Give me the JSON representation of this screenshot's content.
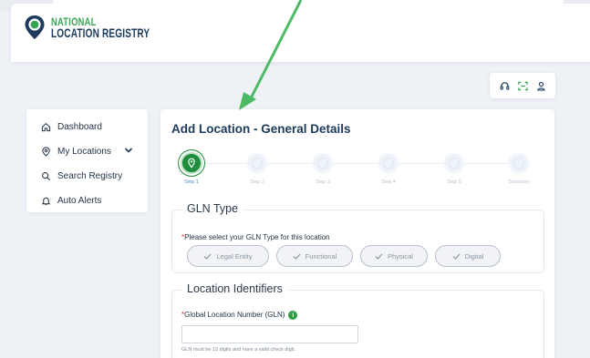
{
  "app": {
    "logo_line1": "NATIONAL",
    "logo_line2": "LOCATION REGISTRY",
    "brand_green": "#3aa655",
    "brand_navy": "#1b3a5c"
  },
  "toolbar": {
    "icons": [
      "headset-icon",
      "scan-icon",
      "user-icon"
    ]
  },
  "sidebar": {
    "items": [
      {
        "label": "Dashboard",
        "icon": "home-icon"
      },
      {
        "label": "My Locations",
        "icon": "location-pin-icon",
        "has_chevron": true
      },
      {
        "label": "Search Registry",
        "icon": "search-icon"
      },
      {
        "label": "Auto Alerts",
        "icon": "bell-icon"
      }
    ]
  },
  "main": {
    "title": "Add Location - General Details",
    "steps": [
      {
        "label": "Step 1",
        "active": true
      },
      {
        "label": "Step 2",
        "active": false
      },
      {
        "label": "Step 3",
        "active": false
      },
      {
        "label": "Step 4",
        "active": false
      },
      {
        "label": "Step 5",
        "active": false
      },
      {
        "label": "Summary",
        "active": false
      }
    ],
    "gln_type": {
      "legend": "GLN Type",
      "required_mark": "*",
      "prompt": "Please select your GLN Type for this location",
      "options": [
        "Legal Entity",
        "Functional",
        "Physical",
        "Digital"
      ]
    },
    "identifiers": {
      "legend": "Location Identifiers",
      "required_mark": "*",
      "gln_label": "Global Location Number (GLN)",
      "info_icon": "i",
      "gln_value": "",
      "hint": "GLN must be 13 digits and have a valid check digit."
    }
  },
  "overlay": {
    "arrow_color": "#4cba63"
  }
}
